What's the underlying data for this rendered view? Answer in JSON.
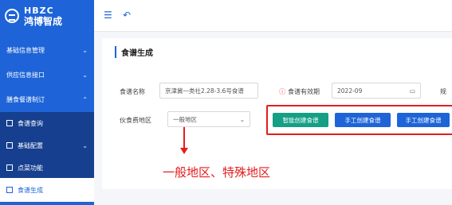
{
  "logo": {
    "en": "HBZC",
    "cn": "鸿博智成"
  },
  "sidebar": {
    "items": [
      {
        "label": "基础信息管理",
        "chev": "⌄"
      },
      {
        "label": "供应信息接口",
        "chev": "⌄"
      },
      {
        "label": "膳食餐谱制订",
        "chev": "⌃"
      }
    ],
    "subitems": [
      {
        "label": "食谱查询",
        "chev": ""
      },
      {
        "label": "基础配置",
        "chev": "⌄"
      },
      {
        "label": "点菜功能",
        "chev": ""
      }
    ],
    "active": {
      "label": "食谱生成"
    }
  },
  "page": {
    "title": "食谱生成"
  },
  "form": {
    "recipe_name_label": "食谱名称",
    "recipe_name_value": "京津冀一类社2.28-3.6号食谱",
    "validity_label": "食谱有效期",
    "validity_value": "2022-09",
    "cutoff_label": "规",
    "food_area_label": "伙食费地区",
    "food_area_value": "一般地区"
  },
  "buttons": {
    "smart": "智能创建食谱",
    "manual1": "手工创建食谱",
    "manual2": "手工创建食谱"
  },
  "annotation": "一般地区、特殊地区",
  "icons": {
    "calendar": "calendar-icon",
    "chevron": "chevron-down-icon"
  },
  "colors": {
    "primary": "#1e64d8",
    "green": "#15a085",
    "red": "#e41d1d"
  }
}
